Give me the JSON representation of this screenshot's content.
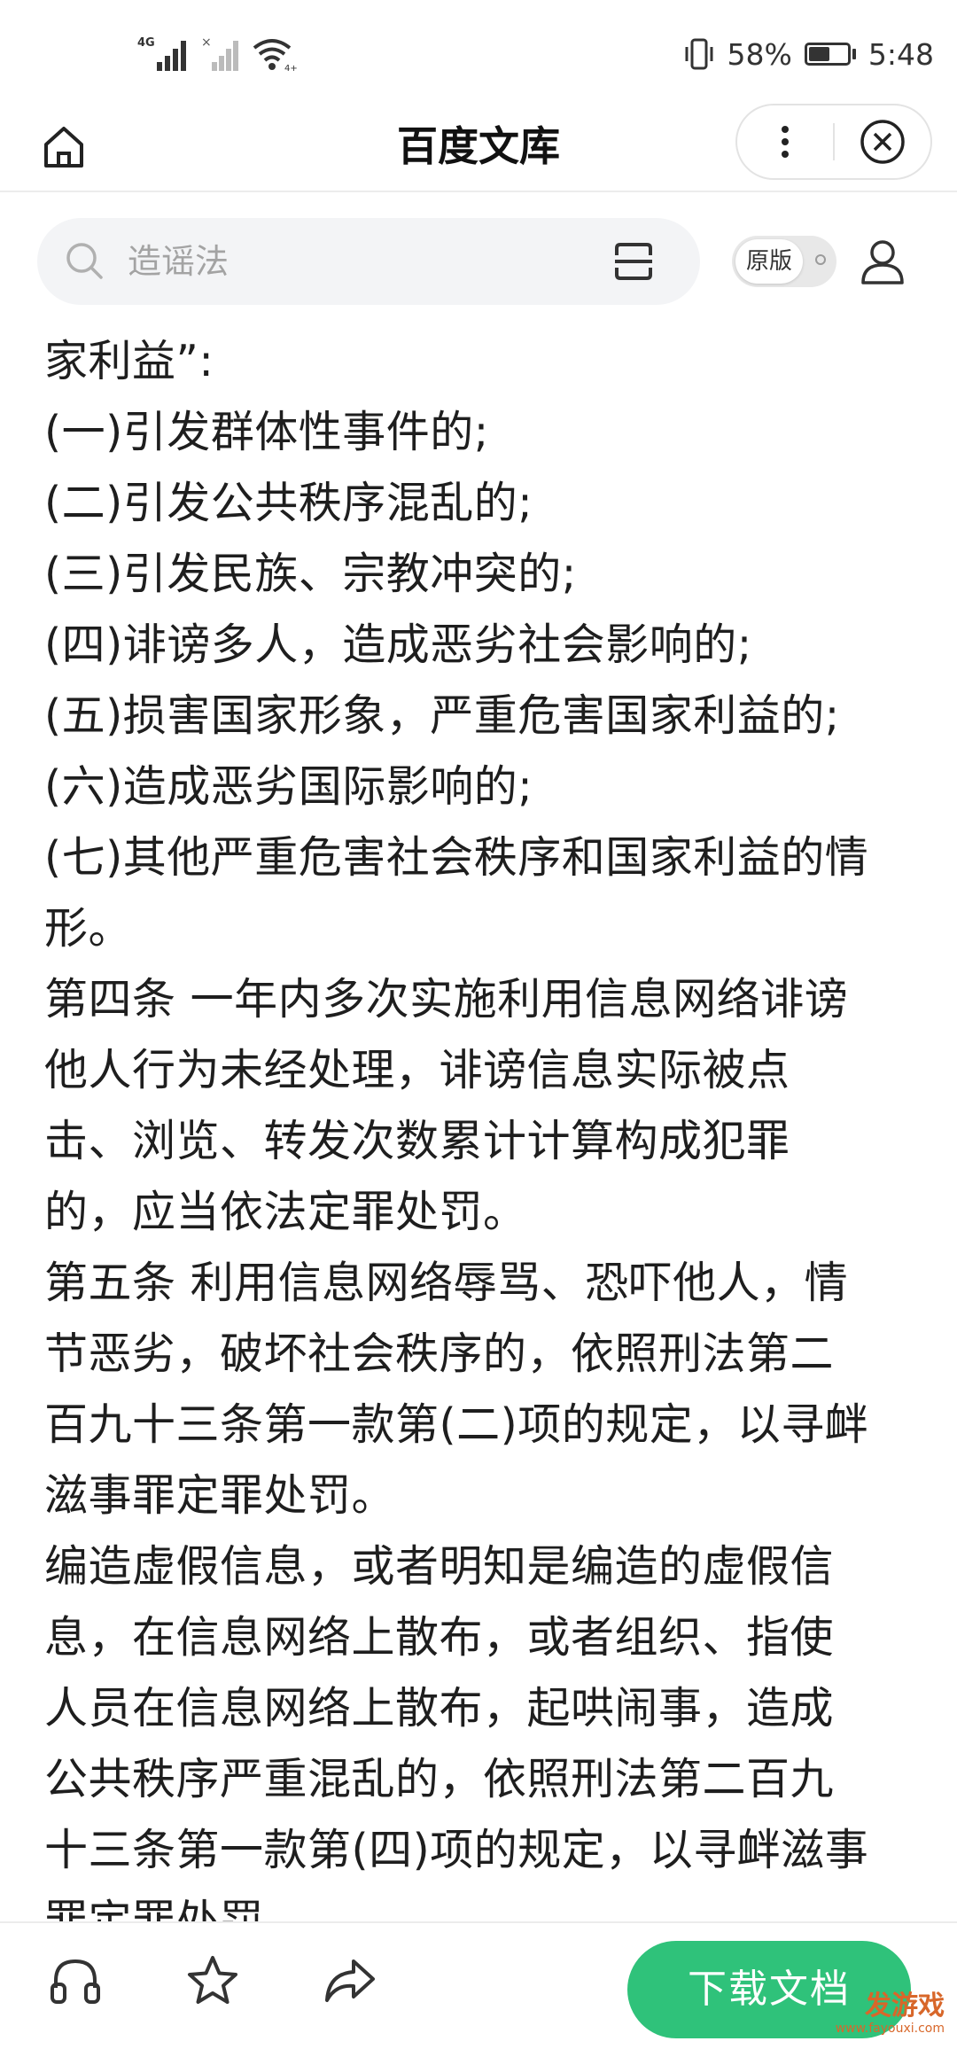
{
  "status_bar": {
    "network": "4G",
    "wifi_badge": "4+",
    "battery_percent": "58%",
    "battery_level": 0.58,
    "time": "5:48"
  },
  "title_bar": {
    "title": "百度文库"
  },
  "search": {
    "query": "造谣法",
    "toggle_label": "原版"
  },
  "document": {
    "lines": [
      "家利益”:",
      "(一)引发群体性事件的;",
      "(二)引发公共秩序混乱的;",
      "(三)引发民族、宗教冲突的;",
      "(四)诽谤多人，造成恶劣社会影响的;",
      "(五)损害国家形象，严重危害国家利益的;",
      "(六)造成恶劣国际影响的;",
      "(七)其他严重危害社会秩序和国家利益的情",
      "形。",
      "第四条 一年内多次实施利用信息网络诽谤",
      "他人行为未经处理，诽谤信息实际被点",
      "击、浏览、转发次数累计计算构成犯罪",
      "的，应当依法定罪处罚。",
      "第五条 利用信息网络辱骂、恐吓他人，情",
      "节恶劣，破坏社会秩序的，依照刑法第二",
      "百九十三条第一款第(二)项的规定，以寻衅",
      "滋事罪定罪处罚。",
      "编造虚假信息，或者明知是编造的虚假信",
      "息，在信息网络上散布，或者组织、指使",
      "人员在信息网络上散布，起哄闹事，造成",
      "公共秩序严重混乱的，依照刑法第二百九",
      "十三条第一款第(四)项的规定，以寻衅滋事",
      "罪定罪处罚。"
    ]
  },
  "bottom_bar": {
    "download_label": "下载文档"
  },
  "watermark": {
    "brand": "发游戏",
    "url": "www.fayouxi.com"
  },
  "colors": {
    "accent_green": "#2fc27a",
    "watermark_orange": "#d8672a"
  }
}
